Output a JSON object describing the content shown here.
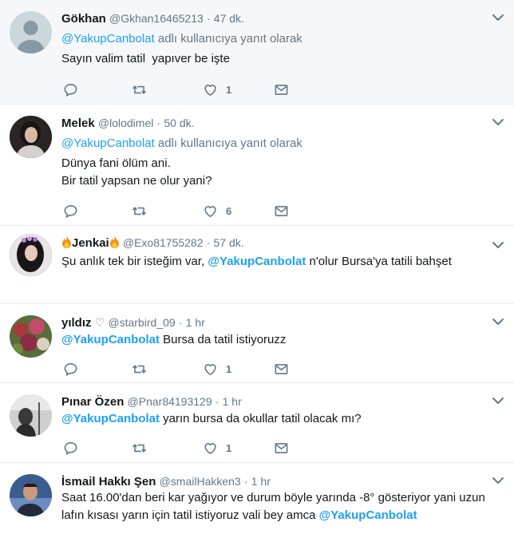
{
  "common": {
    "replying_prefix_end": "adlı kullanıcıya yanıt olarak",
    "dot": "·"
  },
  "tweets": [
    {
      "name": "Gökhan",
      "handle": "@Gkhan16465213",
      "time": "47 dk.",
      "reply_to": "@YakupCanbolat",
      "lines": [
        "Sayın valim tatil  yapıver be işte"
      ],
      "likes": "1"
    },
    {
      "name": "Melek",
      "handle": "@lolodimel",
      "time": "50 dk.",
      "reply_to": "@YakupCanbolat",
      "lines": [
        "Dünya fani ölüm ani.",
        "Bir tatil yapsan ne olur yani?"
      ],
      "likes": "6"
    },
    {
      "name": "Jenkai",
      "handle": "@Exo81755282",
      "time": "57 dk.",
      "text_before": "Şu anlık tek bir isteğim var, ",
      "mention": "@YakupCanbolat",
      "text_after": " n'olur Bursa'ya tatili bahşet"
    },
    {
      "name": "yıldız",
      "name_suffix": "♡",
      "handle": "@starbird_09",
      "time": "1 hr",
      "mention": "@YakupCanbolat",
      "text_after": " Bursa da tatil istiyoruzz",
      "likes": "1"
    },
    {
      "name": "Pınar Özen",
      "handle": "@Pnar84193129",
      "time": "1 hr",
      "mention": "@YakupCanbolat",
      "text_after": " yarın bursa da okullar tatil olacak mı?",
      "likes": "1"
    },
    {
      "name": "İsmail Hakkı Şen",
      "handle": "@smailHakken3",
      "time": "1 hr",
      "line1": "Saat 16.00'dan beri kar yağıyor ve durum böyle yarında -8° gösteriyor yani uzun",
      "line2_before": "lafın kısası yarın için tatil istiyoruz vali bey amca ",
      "mention": "@YakupCanbolat"
    }
  ],
  "colors": {
    "link": "#1da1f2",
    "muted": "#657786",
    "border": "#e6ecf0",
    "highlight_bg": "#f5f8fa"
  }
}
